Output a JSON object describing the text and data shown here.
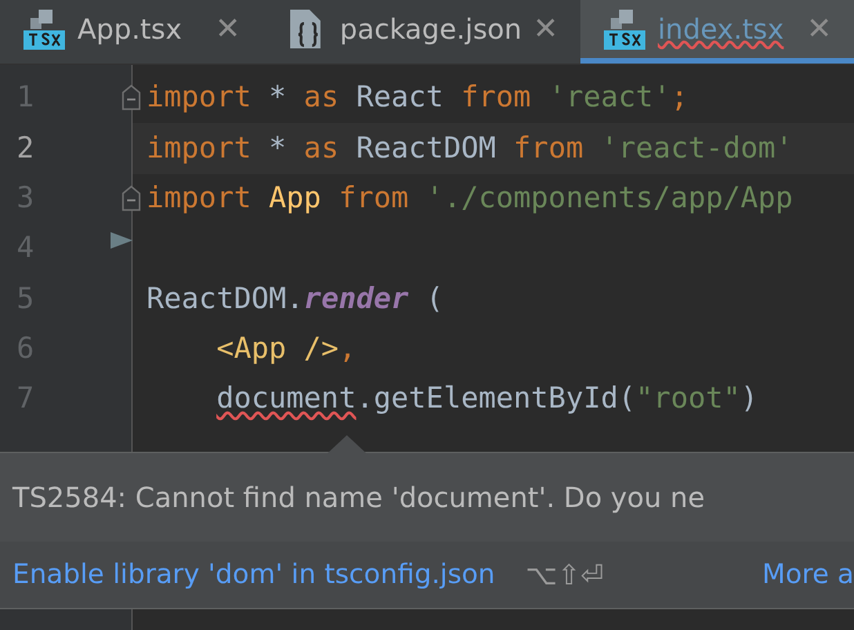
{
  "tabs": [
    {
      "kind": "tsx",
      "label": "App.tsx",
      "close": "✕",
      "selected": false,
      "error": false
    },
    {
      "kind": "json",
      "label": "package.json",
      "close": "✕",
      "selected": false,
      "error": false
    },
    {
      "kind": "tsx",
      "label": "index.tsx",
      "close": "✕",
      "selected": true,
      "error": true
    }
  ],
  "editor": {
    "lines": [
      {
        "number": "1",
        "current": false,
        "fold": true,
        "tokens": [
          {
            "kind": "keyword",
            "text": "import"
          },
          {
            "kind": "plain",
            "text": " * "
          },
          {
            "kind": "keyword",
            "text": "as"
          },
          {
            "kind": "plain",
            "text": " React "
          },
          {
            "kind": "keyword",
            "text": "from"
          },
          {
            "kind": "string",
            "text": " 'react'"
          },
          {
            "kind": "keyword",
            "text": ";"
          }
        ]
      },
      {
        "number": "2",
        "current": true,
        "fold": false,
        "tokens": [
          {
            "kind": "keyword",
            "text": "import"
          },
          {
            "kind": "plain",
            "text": " * "
          },
          {
            "kind": "keyword",
            "text": "as"
          },
          {
            "kind": "plain",
            "text": " ReactDOM "
          },
          {
            "kind": "keyword",
            "text": "from"
          },
          {
            "kind": "string",
            "text": " 'react-dom'"
          }
        ]
      },
      {
        "number": "3",
        "current": false,
        "fold": true,
        "tokens": [
          {
            "kind": "keyword",
            "text": "import"
          },
          {
            "kind": "class",
            "text": " App"
          },
          {
            "kind": "keyword",
            "text": " from"
          },
          {
            "kind": "string",
            "text": " './components/app/App"
          }
        ]
      },
      {
        "number": "4",
        "current": false,
        "fold": false
      },
      {
        "number": "5",
        "current": false,
        "fold": false,
        "tokens": [
          {
            "kind": "plain",
            "text": "ReactDOM."
          },
          {
            "kind": "method",
            "text": "render"
          },
          {
            "kind": "plain",
            "text": " ("
          }
        ]
      },
      {
        "number": "6",
        "current": false,
        "fold": false,
        "tokens": [
          {
            "kind": "tag",
            "text": "    <App />"
          },
          {
            "kind": "keyword",
            "text": ","
          }
        ]
      },
      {
        "number": "7",
        "current": false,
        "fold": false,
        "tokens": [
          {
            "kind": "error",
            "text": "    document"
          },
          {
            "kind": "plain",
            "text": ".getElementById("
          },
          {
            "kind": "string",
            "text": "\"root\""
          },
          {
            "kind": "plain",
            "text": ")"
          }
        ]
      }
    ]
  },
  "tooltip": {
    "message": "TS2584: Cannot find name 'document'. Do you ne",
    "action": "Enable library 'dom' in tsconfig.json",
    "shortcut": "⌥⇧⏎",
    "more": "More a"
  }
}
